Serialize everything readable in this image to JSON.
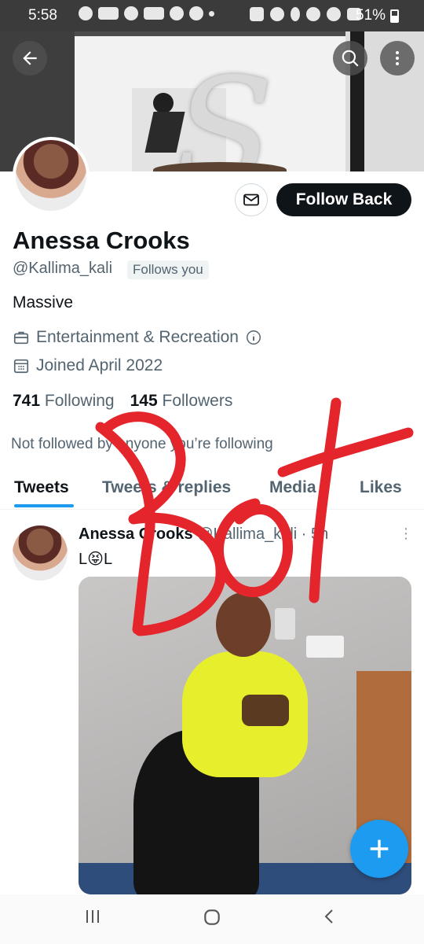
{
  "status_bar": {
    "time": "5:58",
    "battery": "51%"
  },
  "profile": {
    "name": "Anessa Crooks",
    "handle": "@Kallima_kali",
    "follows_you": "Follows you",
    "bio": "Massive",
    "category": "Entertainment & Recreation",
    "joined": "Joined April 2022",
    "following_count": "741",
    "following_label": "Following",
    "followers_count": "145",
    "followers_label": "Followers",
    "not_followed": "Not followed by anyone you’re following",
    "follow_button": "Follow Back"
  },
  "tabs": [
    "Tweets",
    "Tweets & replies",
    "Media",
    "Likes"
  ],
  "active_tab": "Tweets",
  "tweet": {
    "author": "Anessa Crooks",
    "handle": "@Kallima_kali",
    "time": "5h",
    "text": "L😝L"
  },
  "overlay": {
    "text": "Bot",
    "color": "#e4262c"
  },
  "colors": {
    "accent": "#1d9bf0",
    "primary_button": "#0f1419"
  },
  "icons": [
    "back-arrow-icon",
    "search-icon",
    "more-vert-icon",
    "mail-icon",
    "briefcase-icon",
    "info-icon",
    "calendar-icon",
    "plus-icon"
  ]
}
